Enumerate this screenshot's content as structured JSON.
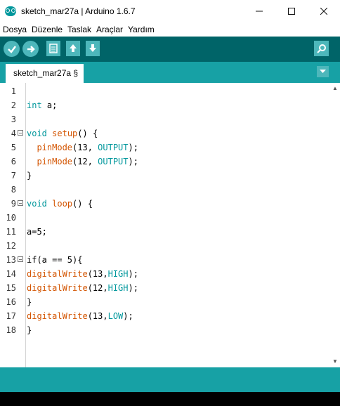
{
  "window": {
    "title": "sketch_mar27a | Arduino 1.6.7"
  },
  "menu": [
    "Dosya",
    "Düzenle",
    "Taslak",
    "Araçlar",
    "Yardım"
  ],
  "toolbar": {
    "buttons": [
      "verify",
      "upload",
      "new",
      "open",
      "save"
    ],
    "serial_monitor": "serial-monitor"
  },
  "tabs": [
    {
      "label": "sketch_mar27a §"
    }
  ],
  "editor": {
    "lines": [
      {
        "n": "1",
        "tokens": []
      },
      {
        "n": "2",
        "tokens": [
          {
            "t": "int",
            "c": "type"
          },
          {
            "t": " a;",
            "c": ""
          }
        ]
      },
      {
        "n": "3",
        "tokens": []
      },
      {
        "n": "4",
        "fold": true,
        "tokens": [
          {
            "t": "void",
            "c": "type"
          },
          {
            "t": " ",
            "c": ""
          },
          {
            "t": "setup",
            "c": "func"
          },
          {
            "t": "() {",
            "c": ""
          }
        ]
      },
      {
        "n": "5",
        "tokens": [
          {
            "t": "  ",
            "c": ""
          },
          {
            "t": "pinMode",
            "c": "func"
          },
          {
            "t": "(13, ",
            "c": ""
          },
          {
            "t": "OUTPUT",
            "c": "const"
          },
          {
            "t": ");",
            "c": ""
          }
        ]
      },
      {
        "n": "6",
        "tokens": [
          {
            "t": "  ",
            "c": ""
          },
          {
            "t": "pinMode",
            "c": "func"
          },
          {
            "t": "(12, ",
            "c": ""
          },
          {
            "t": "OUTPUT",
            "c": "const"
          },
          {
            "t": ");",
            "c": ""
          }
        ]
      },
      {
        "n": "7",
        "tokens": [
          {
            "t": "}",
            "c": ""
          }
        ]
      },
      {
        "n": "8",
        "tokens": []
      },
      {
        "n": "9",
        "fold": true,
        "tokens": [
          {
            "t": "void",
            "c": "type"
          },
          {
            "t": " ",
            "c": ""
          },
          {
            "t": "loop",
            "c": "func"
          },
          {
            "t": "() {",
            "c": ""
          }
        ]
      },
      {
        "n": "10",
        "tokens": []
      },
      {
        "n": "11",
        "tokens": [
          {
            "t": "a=5;",
            "c": ""
          }
        ]
      },
      {
        "n": "12",
        "tokens": []
      },
      {
        "n": "13",
        "fold": true,
        "tokens": [
          {
            "t": "if(a == 5){",
            "c": ""
          }
        ]
      },
      {
        "n": "14",
        "tokens": [
          {
            "t": "digitalWrite",
            "c": "func"
          },
          {
            "t": "(13,",
            "c": ""
          },
          {
            "t": "HIGH",
            "c": "const"
          },
          {
            "t": ");",
            "c": ""
          }
        ]
      },
      {
        "n": "15",
        "tokens": [
          {
            "t": "digitalWrite",
            "c": "func"
          },
          {
            "t": "(12,",
            "c": ""
          },
          {
            "t": "HIGH",
            "c": "const"
          },
          {
            "t": ");",
            "c": ""
          }
        ]
      },
      {
        "n": "16",
        "tokens": [
          {
            "t": "}",
            "c": ""
          }
        ]
      },
      {
        "n": "17",
        "tokens": [
          {
            "t": "digitalWrite",
            "c": "func"
          },
          {
            "t": "(13,",
            "c": ""
          },
          {
            "t": "LOW",
            "c": "const"
          },
          {
            "t": ");",
            "c": ""
          }
        ]
      },
      {
        "n": "18",
        "tokens": [
          {
            "t": "}",
            "c": ""
          }
        ]
      }
    ]
  },
  "colors": {
    "toolbar": "#006468",
    "tabbar": "#17a1a5",
    "accent": "#00979c",
    "function": "#d35400"
  }
}
